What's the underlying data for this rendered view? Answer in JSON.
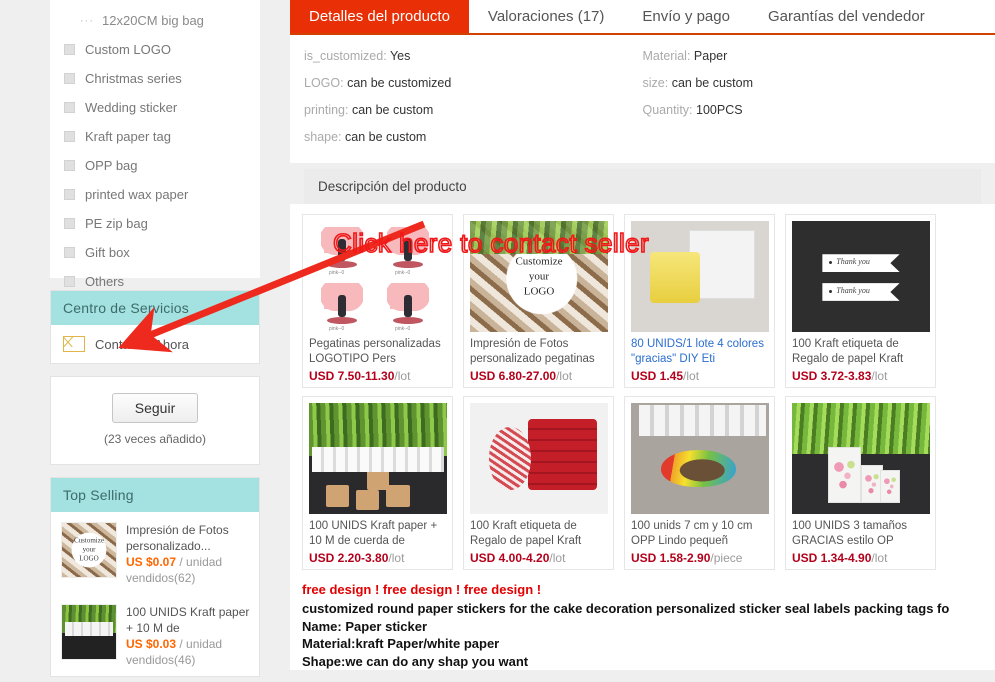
{
  "sidebar": {
    "categories": [
      {
        "label": "12x20CM big bag",
        "sub": true
      },
      {
        "label": "Custom LOGO",
        "sub": false
      },
      {
        "label": "Christmas series",
        "sub": false
      },
      {
        "label": "Wedding sticker",
        "sub": false
      },
      {
        "label": "Kraft paper tag",
        "sub": false
      },
      {
        "label": "OPP bag",
        "sub": false
      },
      {
        "label": "printed wax paper",
        "sub": false
      },
      {
        "label": "PE zip bag",
        "sub": false
      },
      {
        "label": "Gift box",
        "sub": false
      },
      {
        "label": "Others",
        "sub": false
      }
    ],
    "service_center": {
      "title": "Centro de Servicios",
      "contact_label": "Contactar Ahora"
    },
    "follow": {
      "button_label": "Seguir",
      "note": "(23 veces añadido)"
    },
    "top_selling": {
      "title": "Top Selling",
      "items": [
        {
          "title": "Impresión de Fotos personalizado...",
          "price": "US $0.07",
          "unit": "/ unidad",
          "sold": "vendidos(62)",
          "thumb": "thumb-logo"
        },
        {
          "title": "100 UNIDS Kraft paper + 10 M de",
          "price": "US $0.03",
          "unit": "/ unidad",
          "sold": "vendidos(46)",
          "thumb": "thumb-kraft"
        }
      ]
    }
  },
  "main": {
    "tabs": [
      {
        "label": "Detalles del producto",
        "active": true
      },
      {
        "label": "Valoraciones (17)",
        "active": false
      },
      {
        "label": "Envío y pago",
        "active": false
      },
      {
        "label": "Garantías del vendedor",
        "active": false
      }
    ],
    "attributes_left": [
      {
        "key": "is_customized:",
        "value": "Yes"
      },
      {
        "key": "LOGO:",
        "value": "can be customized"
      },
      {
        "key": "printing:",
        "value": "can be custom"
      },
      {
        "key": "shape:",
        "value": "can be custom"
      }
    ],
    "attributes_right": [
      {
        "key": "Material:",
        "value": "Paper"
      },
      {
        "key": "size:",
        "value": "can be custom"
      },
      {
        "key": "Quantity:",
        "value": "100PCS"
      }
    ],
    "description_bar": "Descripción del producto",
    "products": [
      {
        "title": "Pegatinas personalizadas LOGOTIPO Pers",
        "price": "USD 7.50-11.30",
        "unit": "/lot",
        "art": "img-wedding",
        "link": false
      },
      {
        "title": "Impresión de Fotos personalizado pegatinas",
        "price": "USD 6.80-27.00",
        "unit": "/lot",
        "art": "img-logo",
        "link": false
      },
      {
        "title": "80 UNIDS/1 lote 4 colores \"gracias\" DIY Eti",
        "price": "USD 1.45",
        "unit": "/lot",
        "art": "img-pack",
        "link": true
      },
      {
        "title": "100 Kraft etiqueta de Regalo de papel Kraft",
        "price": "USD 3.72-3.83",
        "unit": "/lot",
        "art": "img-thanks",
        "link": false
      },
      {
        "title": "100 UNIDS Kraft paper + 10 M de cuerda de",
        "price": "USD 2.20-3.80",
        "unit": "/lot",
        "art": "img-plant",
        "link": false
      },
      {
        "title": "100 Kraft etiqueta de Regalo de papel Kraft",
        "price": "USD 4.00-4.20",
        "unit": "/lot",
        "art": "img-red",
        "link": false
      },
      {
        "title": "100 unids 7 cm y 10 cm OPP Lindo pequeñ",
        "price": "USD 1.58-2.90",
        "unit": "/piece",
        "art": "img-monster",
        "link": false
      },
      {
        "title": "100 UNIDS 3 tamaños GRACIAS estilo OP",
        "price": "USD 1.34-4.90",
        "unit": "/lot",
        "art": "img-floral",
        "link": false
      }
    ],
    "description_text": {
      "free_design": "free design !   free design !   free design !",
      "lines": [
        "customized round paper stickers for the cake decoration personalized sticker seal labels packing tags fo",
        "Name:   Paper sticker",
        "Material:kraft Paper/white paper",
        "Shape:we can do any shap you want"
      ]
    }
  },
  "annotation": {
    "text": "Click here to contact seller",
    "color": "#f01818"
  }
}
